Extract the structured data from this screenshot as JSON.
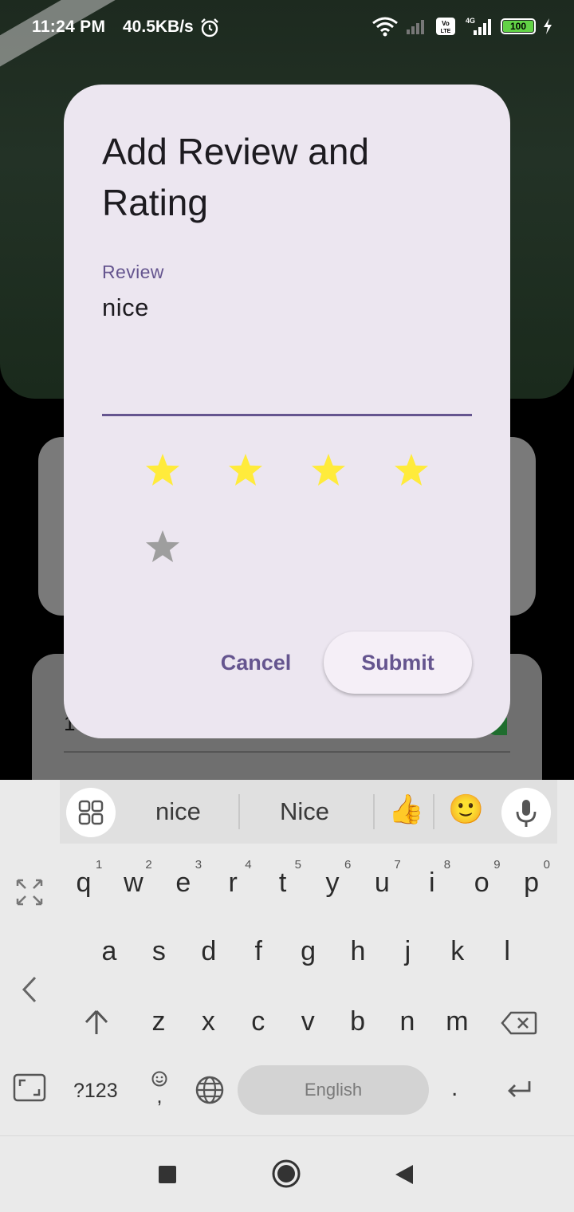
{
  "status_bar": {
    "time": "11:24 PM",
    "network_speed": "40.5KB/s",
    "battery_level": "100",
    "network_type": "4G",
    "volte": "Vo LTE"
  },
  "dialog": {
    "title": "Add Review and Rating",
    "review_field": {
      "label": "Review",
      "value": "nice"
    },
    "rating": {
      "value": 4,
      "max": 5,
      "filled_color": "#ffeb3b",
      "empty_color": "#9e9e9e"
    },
    "cancel_label": "Cancel",
    "submit_label": "Submit",
    "accent_color": "#65558f"
  },
  "keyboard": {
    "suggestions": [
      "nice",
      "Nice"
    ],
    "emoji_suggestions": [
      "👍",
      "🙂"
    ],
    "row1": [
      "q",
      "w",
      "e",
      "r",
      "t",
      "y",
      "u",
      "i",
      "o",
      "p"
    ],
    "row1_hints": [
      "1",
      "2",
      "3",
      "4",
      "5",
      "6",
      "7",
      "8",
      "9",
      "0"
    ],
    "row2": [
      "a",
      "s",
      "d",
      "f",
      "g",
      "h",
      "j",
      "k",
      "l"
    ],
    "row3": [
      "z",
      "x",
      "c",
      "v",
      "b",
      "n",
      "m"
    ],
    "symbols_label": "?123",
    "emoji_comma_label": ",",
    "space_label": "English",
    "period_label": "."
  }
}
